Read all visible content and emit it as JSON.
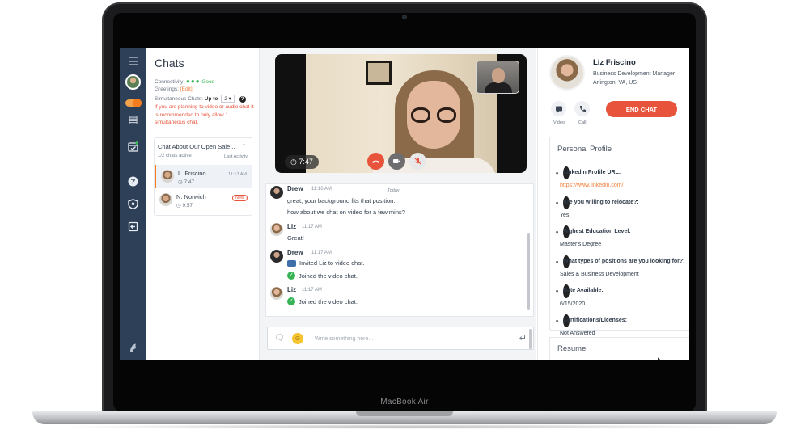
{
  "device": {
    "label": "MacBook Air"
  },
  "rail": {
    "icons": [
      "menu-icon",
      "avatar",
      "status-toggle",
      "notes-icon",
      "calendar-check-icon",
      "help-icon",
      "shield-icon",
      "exit-icon",
      "brand-logo-icon"
    ]
  },
  "chats": {
    "title": "Chats",
    "connectivity_label": "Connectivity:",
    "connectivity_value": "Good",
    "greetings_label": "Greetings:",
    "greetings_edit": "[Edit]",
    "simultaneous_label": "Simultaneous Chats:",
    "simultaneous_prefix": "Up to",
    "simultaneous_value": "2",
    "help_glyph": "?",
    "warning": "If you are planning to video or audio chat it is recommended to only allow 1 simultaneous chat.",
    "group": {
      "title": "Chat About Our Open Sale...",
      "active": "1/2 chats active",
      "sort_label": "Last Activity",
      "items": [
        {
          "name": "L. Friscino",
          "duration": "7:47",
          "time": "11:17 AM"
        },
        {
          "name": "N. Norwich",
          "duration": "9:57",
          "badge": "New"
        }
      ]
    }
  },
  "video": {
    "timer": "7:47"
  },
  "messages": {
    "date_divider": "Today",
    "items": [
      {
        "sender": "Drew",
        "time": "11:16 AM",
        "lines": [
          "great, your background fits that position.",
          "how about we chat on video for a few mins?"
        ]
      },
      {
        "sender": "Liz",
        "time": "11:17 AM",
        "lines": [
          "Great!"
        ]
      },
      {
        "sender": "Drew",
        "time": "11:17 AM",
        "events": [
          "Invited Liz to video chat.",
          "Joined the video chat."
        ]
      },
      {
        "sender": "Liz",
        "time": "11:17 AM",
        "events": [
          "Joined the video chat."
        ]
      }
    ]
  },
  "composer": {
    "placeholder": "Write something here..."
  },
  "profile": {
    "name": "Liz Friscino",
    "title": "Business Development Manager",
    "location": "Arlington, VA, US",
    "video_label": "Video",
    "call_label": "Call",
    "end_chat_label": "END CHAT",
    "section_title": "Personal Profile",
    "fields": [
      {
        "question": "LinkedIn Profile URL:",
        "answer": "https://www.linkedin.com/"
      },
      {
        "question": "Are you willing to relocate?:",
        "answer": "Yes"
      },
      {
        "question": "Highest Education Level:",
        "answer": "Master's Degree"
      },
      {
        "question": "What types of positions are you looking for?:",
        "answer": "Sales & Business Development"
      },
      {
        "question": "Date Available:",
        "answer": "6/15/2020"
      },
      {
        "question": "Certifications/Licenses:",
        "answer": "Not Answered"
      }
    ],
    "resume_title": "Resume"
  },
  "colors": {
    "rail": "#2e4058",
    "accent_orange": "#f57c1f",
    "danger_red": "#e8533c",
    "good_green": "#36b455"
  }
}
